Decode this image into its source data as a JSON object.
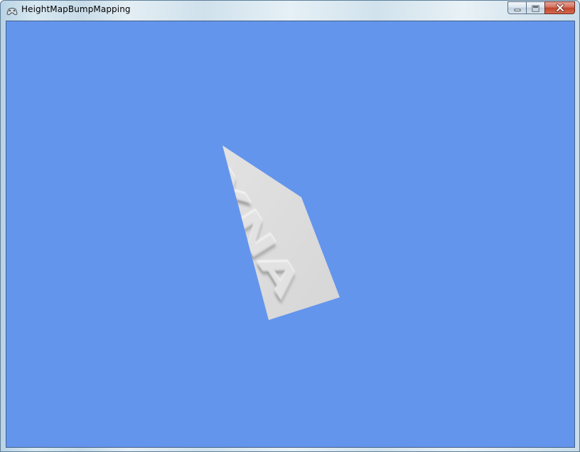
{
  "window": {
    "title": "HeightMapBumpMapping",
    "icon": "gamepad-icon"
  },
  "caption_buttons": {
    "minimize_icon": "minimize-icon",
    "maximize_icon": "maximize-icon",
    "close_icon": "close-icon"
  },
  "viewport": {
    "clear_color": "#6495ed",
    "quad_color": "#d9d9d9",
    "embossed_text": "XNA"
  }
}
